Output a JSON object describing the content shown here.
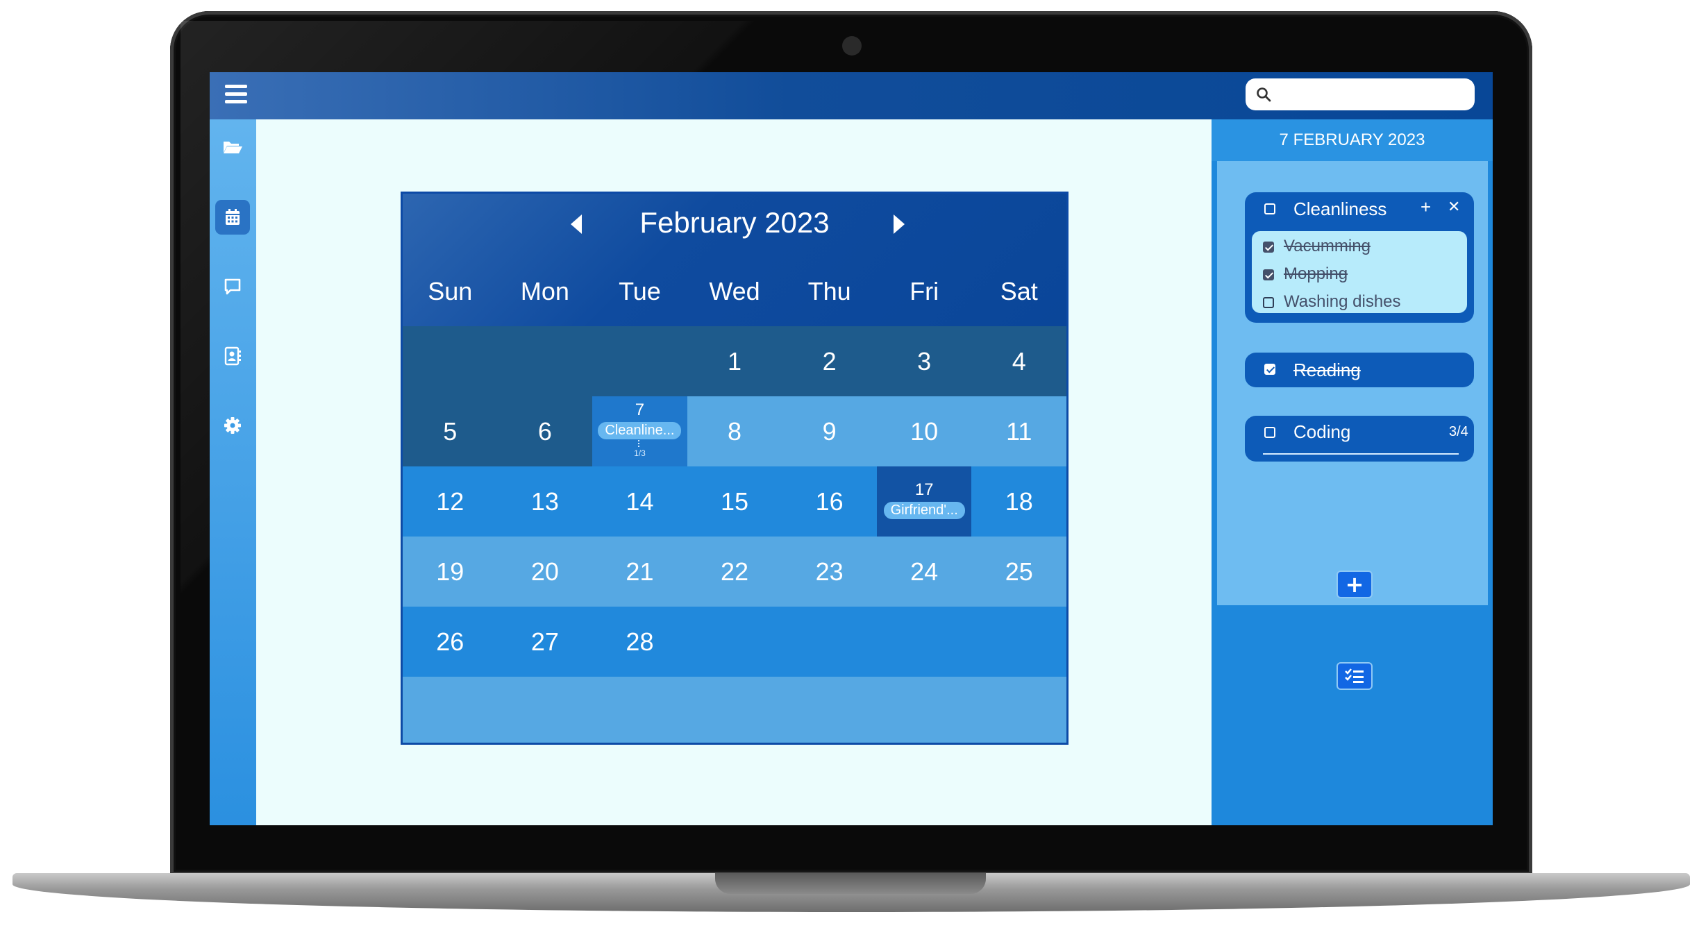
{
  "search": {
    "placeholder": ""
  },
  "sidebar": {
    "items": [
      {
        "icon": "folder-open-icon"
      },
      {
        "icon": "calendar-icon",
        "active": true
      },
      {
        "icon": "message-icon"
      },
      {
        "icon": "contact-book-icon"
      },
      {
        "icon": "gear-icon"
      }
    ]
  },
  "calendar": {
    "title": "February 2023",
    "weekdays": [
      "Sun",
      "Mon",
      "Tue",
      "Wed",
      "Thu",
      "Fri",
      "Sat"
    ],
    "weeks": [
      [
        "",
        "",
        "",
        "1",
        "2",
        "3",
        "4"
      ],
      [
        "5",
        "6",
        "7",
        "8",
        "9",
        "10",
        "11"
      ],
      [
        "12",
        "13",
        "14",
        "15",
        "16",
        "17",
        "18"
      ],
      [
        "19",
        "20",
        "21",
        "22",
        "23",
        "24",
        "25"
      ],
      [
        "26",
        "27",
        "28",
        "",
        "",
        "",
        ""
      ]
    ],
    "events": {
      "day7": {
        "label": "Cleanline...",
        "count": "1/3"
      },
      "day17": {
        "label": "Girfriend'..."
      }
    }
  },
  "panel": {
    "date": "7 FEBRUARY 2023",
    "tasks": [
      {
        "title": "Cleanliness",
        "done": false,
        "subtasks": [
          {
            "title": "Vacumming",
            "done": true
          },
          {
            "title": "Mopping",
            "done": true
          },
          {
            "title": "Washing dishes",
            "done": false
          }
        ]
      },
      {
        "title": "Reading",
        "done": true
      },
      {
        "title": "Coding",
        "done": false,
        "progress": "3/4"
      }
    ]
  },
  "colors": {
    "topbar": "#084797",
    "accent": "#1e88dc",
    "calendar_header": "#0a4699"
  }
}
